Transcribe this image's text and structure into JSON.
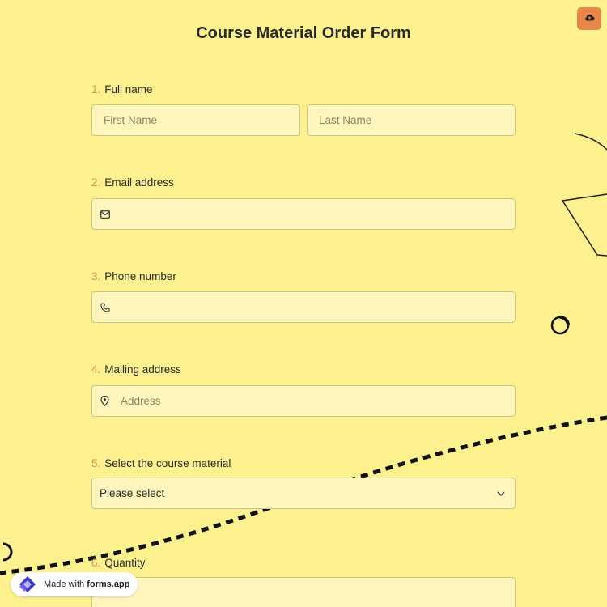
{
  "form": {
    "title": "Course Material Order Form"
  },
  "questions": [
    {
      "num": "1.",
      "label": "Full name"
    },
    {
      "num": "2.",
      "label": "Email address"
    },
    {
      "num": "3.",
      "label": "Phone number"
    },
    {
      "num": "4.",
      "label": "Mailing address"
    },
    {
      "num": "5.",
      "label": "Select the course material"
    },
    {
      "num": "6.",
      "label": "Quantity"
    }
  ],
  "fields": {
    "first_name_placeholder": "First Name",
    "last_name_placeholder": "Last Name",
    "address_placeholder": "Address",
    "course_select_value": "Please select"
  },
  "icons": {
    "upload": "cloud-upload-icon",
    "email": "envelope-icon",
    "phone": "phone-icon",
    "address": "map-pin-icon",
    "select": "chevron-down-icon",
    "brand": "forms-app-logo-icon"
  },
  "badge": {
    "prefix": "Made with ",
    "brand": "forms.app"
  },
  "colors": {
    "background": "#fdf08e",
    "field_bg": "#fff6bd",
    "accent": "#e8874a",
    "number": "#d8935a"
  }
}
